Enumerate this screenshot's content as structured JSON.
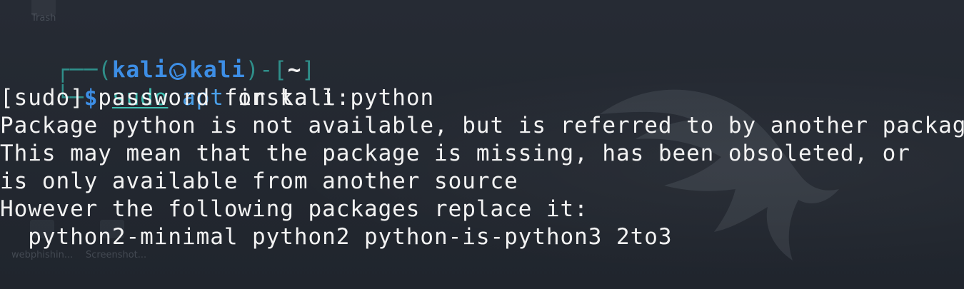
{
  "desktop": {
    "icons": [
      {
        "label": "Trash"
      },
      {
        "label": "webphishin..."
      },
      {
        "label": "Screenshot..."
      }
    ]
  },
  "terminal": {
    "prompt": {
      "box_top_left": "┌──(",
      "user": "kali",
      "host": "kali",
      "close_paren_bracket": ")-[",
      "cwd": "~",
      "close_bracket": "]",
      "box_bottom_left": "└─",
      "symbol": "$",
      "command": {
        "sudo": "sudo",
        "apt": "apt",
        "args": "install python"
      }
    },
    "output": [
      "[sudo] password for kali:",
      "Package python is not available, but is referred to by another package.",
      "This may mean that the package is missing, has been obsoleted, or",
      "is only available from another source",
      "However the following packages replace it:",
      "  python2-minimal python2 python-is-python3 2to3"
    ]
  },
  "colors": {
    "background": "#232831",
    "prompt_box": "#2f8f8a",
    "user_host": "#3d8ee5",
    "sudo": "#3fbfb2",
    "apt": "#4a9fe8",
    "text": "#f2f2f2"
  },
  "icons": {
    "prompt_separator": "kali-dragon-icon",
    "desktop_watermark": "kali-dragon-watermark-icon"
  }
}
